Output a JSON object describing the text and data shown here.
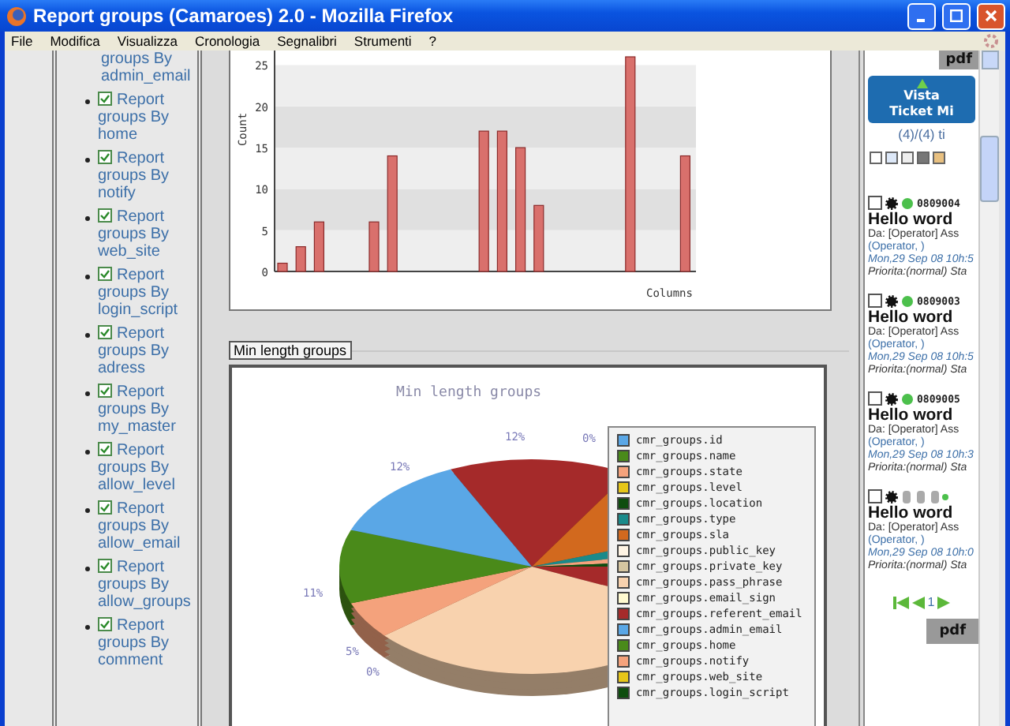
{
  "window": {
    "title": "Report groups (Camaroes) 2.0 - Mozilla Firefox"
  },
  "menu": [
    "File",
    "Modifica",
    "Visualizza",
    "Cronologia",
    "Segnalibri",
    "Strumenti",
    "?"
  ],
  "sidebar": {
    "top_text": "groups By admin_email",
    "items": [
      {
        "label": "Report groups By home",
        "checked": true
      },
      {
        "label": "Report groups By notify",
        "checked": true
      },
      {
        "label": "Report groups By web_site",
        "checked": true
      },
      {
        "label": "Report groups By login_script",
        "checked": true
      },
      {
        "label": "Report groups By adress",
        "checked": true
      },
      {
        "label": "Report groups By my_master",
        "checked": true
      },
      {
        "label": "Report groups By allow_level",
        "checked": true
      },
      {
        "label": "Report groups By allow_email",
        "checked": true
      },
      {
        "label": "Report groups By allow_groups",
        "checked": true
      },
      {
        "label": "Report groups By comment",
        "checked": true
      }
    ]
  },
  "bar_chart": {
    "chart_data": {
      "type": "bar",
      "xlabel": "Columns",
      "ylabel": "Count",
      "ylim": [
        0,
        26
      ],
      "yticks": [
        0,
        5,
        10,
        15,
        20,
        25
      ],
      "series": [
        {
          "color": "#d9706c",
          "values": [
            1,
            3,
            6,
            0,
            0,
            6,
            14,
            0,
            0,
            0,
            0,
            17,
            17,
            15,
            8,
            0,
            0,
            0,
            0,
            26,
            0,
            0,
            14
          ]
        }
      ]
    }
  },
  "pie_section": {
    "caption": "Min length groups",
    "title": "Min length groups",
    "percent_labels": [
      "12%",
      "0%",
      "12%",
      "11%",
      "5%",
      "0%"
    ],
    "legend": [
      {
        "label": "cmr_groups.id",
        "color": "#5aa7e6"
      },
      {
        "label": "cmr_groups.name",
        "color": "#4a8a1a"
      },
      {
        "label": "cmr_groups.state",
        "color": "#f4a27c"
      },
      {
        "label": "cmr_groups.level",
        "color": "#e6c619"
      },
      {
        "label": "cmr_groups.location",
        "color": "#0e4d0e"
      },
      {
        "label": "cmr_groups.type",
        "color": "#1a8a8a"
      },
      {
        "label": "cmr_groups.sla",
        "color": "#d2691e"
      },
      {
        "label": "cmr_groups.public_key",
        "color": "#fff4e4"
      },
      {
        "label": "cmr_groups.private_key",
        "color": "#d6c6a0"
      },
      {
        "label": "cmr_groups.pass_phrase",
        "color": "#f8d2ae"
      },
      {
        "label": "cmr_groups.email_sign",
        "color": "#fffad0"
      },
      {
        "label": "cmr_groups.referent_email",
        "color": "#a52a2a"
      },
      {
        "label": "cmr_groups.admin_email",
        "color": "#5aa7e6"
      },
      {
        "label": "cmr_groups.home",
        "color": "#4a8a1a"
      },
      {
        "label": "cmr_groups.notify",
        "color": "#f4a27c"
      },
      {
        "label": "cmr_groups.web_site",
        "color": "#e6c619"
      },
      {
        "label": "cmr_groups.login_script",
        "color": "#0e4d0e"
      }
    ]
  },
  "right_panel": {
    "top_button": "pdf",
    "header": [
      "Vista",
      "Ticket Mi"
    ],
    "count": "(4)/(4) ti",
    "select_all_checked": false,
    "tickets": [
      {
        "number": "0809004",
        "title": "Hello word",
        "from": "Da: [Operator] Ass",
        "assignee": "(Operator, )",
        "date": "Mon,29 Sep 08 10h:5",
        "priority": "Priorita:(normal) Sta",
        "checked": false
      },
      {
        "number": "0809003",
        "title": "Hello word",
        "from": "Da: [Operator] Ass",
        "assignee": "(Operator, )",
        "date": "Mon,29 Sep 08 10h:5",
        "priority": "Priorita:(normal) Sta",
        "checked": false
      },
      {
        "number": "0809005",
        "title": "Hello word",
        "from": "Da: [Operator] Ass",
        "assignee": "(Operator, )",
        "date": "Mon,29 Sep 08 10h:3",
        "priority": "Priorita:(normal) Sta",
        "checked": false
      },
      {
        "title": "Hello word",
        "from": "Da: [Operator] Ass",
        "assignee": "(Operator, )",
        "date": "Mon,29 Sep 08 10h:0",
        "priority": "Priorita:(normal) Sta",
        "checked": false
      }
    ],
    "page": "1",
    "pdf_button": "pdf"
  }
}
